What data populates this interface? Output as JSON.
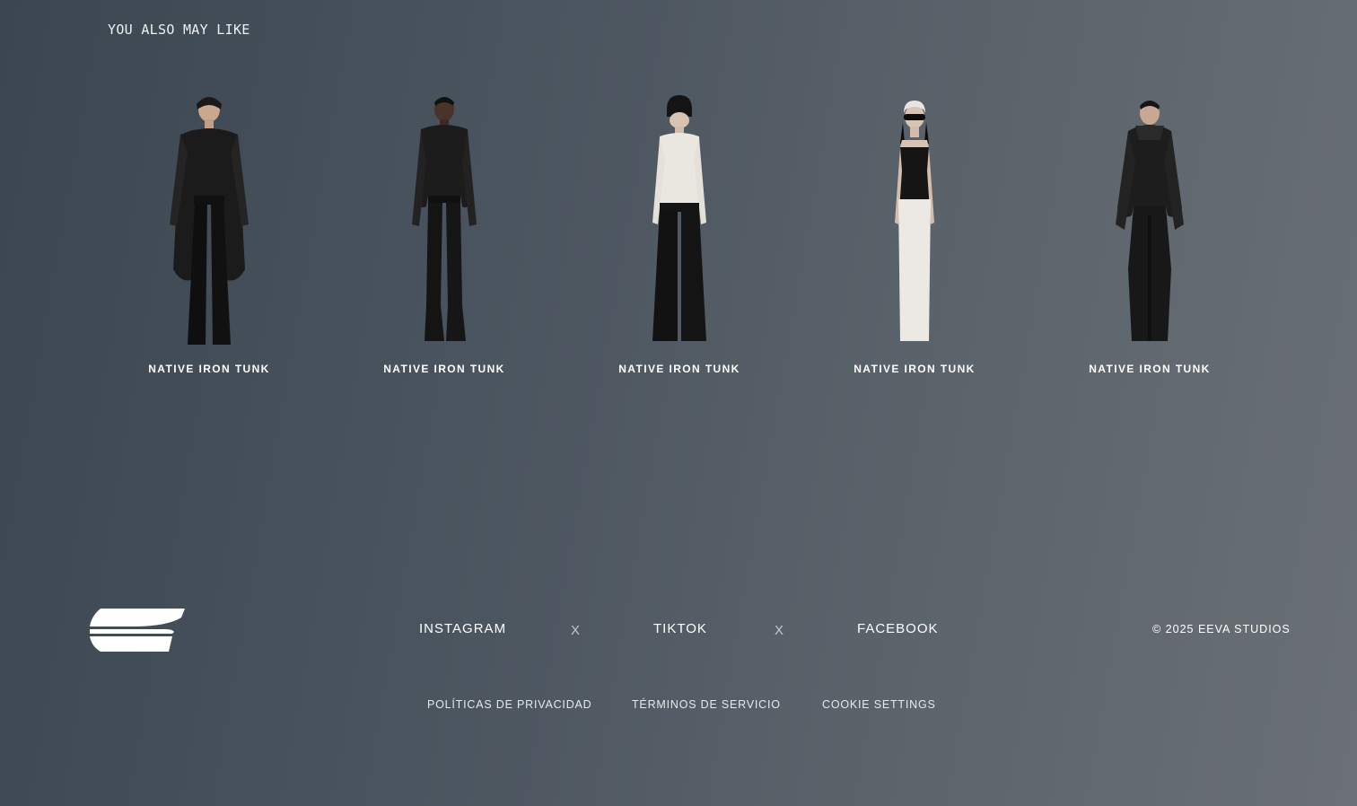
{
  "recommendations": {
    "title": "YOU ALSO MAY LIKE",
    "products": [
      {
        "name": "NATIVE IRON TUNK"
      },
      {
        "name": "NATIVE IRON TUNK"
      },
      {
        "name": "NATIVE IRON TUNK"
      },
      {
        "name": "NATIVE IRON TUNK"
      },
      {
        "name": "NATIVE IRON TUNK"
      }
    ]
  },
  "footer": {
    "logo_icon": "eeva-logo-icon",
    "social": {
      "instagram": "INSTAGRAM",
      "tiktok": "TIKTOK",
      "facebook": "FACEBOOK",
      "separator": "X"
    },
    "copyright": "© 2025 EEVA STUDIOS",
    "legal": {
      "privacy": "POLÍTICAS DE PRIVACIDAD",
      "terms": "TÉRMINOS DE SERVICIO",
      "cookies": "COOKIE SETTINGS"
    }
  }
}
